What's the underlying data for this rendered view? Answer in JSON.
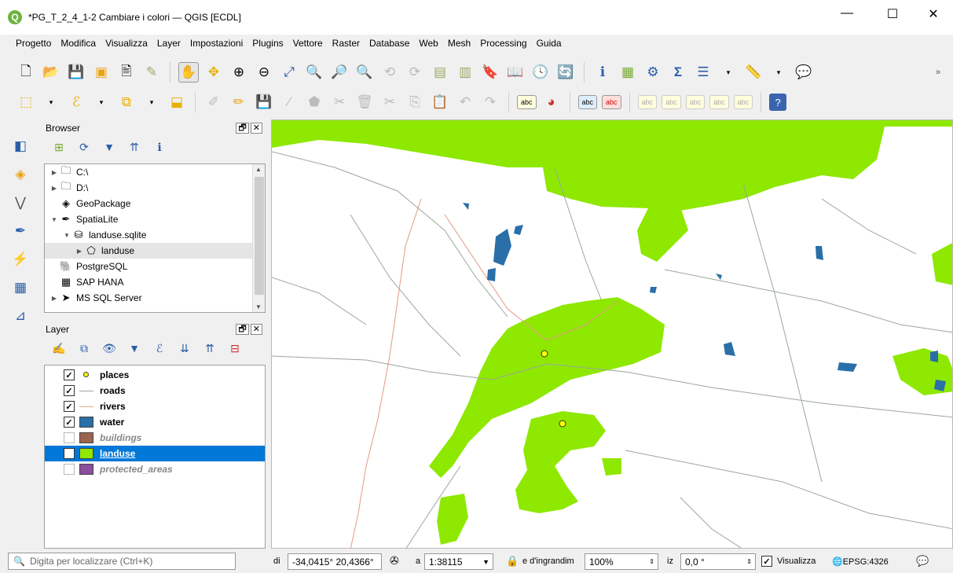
{
  "window": {
    "title": "*PG_T_2_4_1-2 Cambiare i colori — QGIS [ECDL]",
    "logo": "Q",
    "minimize": "—",
    "maximize": "☐",
    "close": "✕"
  },
  "menu": [
    "Progetto",
    "Modifica",
    "Visualizza",
    "Layer",
    "Impostazioni",
    "Plugins",
    "Vettore",
    "Raster",
    "Database",
    "Web",
    "Mesh",
    "Processing",
    "Guida"
  ],
  "toolbar2": {
    "label_abc": "abc"
  },
  "browser": {
    "title": "Browser",
    "float_btn": "🗗",
    "close_btn": "✕",
    "items": [
      {
        "label": "C:\\",
        "icon": "folder-icon",
        "glyph": "🗀",
        "expand": "▶",
        "indent": 0
      },
      {
        "label": "D:\\",
        "icon": "folder-icon",
        "glyph": "🗀",
        "expand": "▶",
        "indent": 0
      },
      {
        "label": "GeoPackage",
        "icon": "geopackage-icon",
        "glyph": "◈",
        "expand": "",
        "indent": 0
      },
      {
        "label": "SpatiaLite",
        "icon": "spatialite-icon",
        "glyph": "✒",
        "expand": "▼",
        "indent": 0
      },
      {
        "label": "landuse.sqlite",
        "icon": "database-icon",
        "glyph": "⛁",
        "expand": "▼",
        "indent": 1
      },
      {
        "label": "landuse",
        "icon": "polygon-layer-icon",
        "glyph": "⬠",
        "expand": "▶",
        "indent": 2
      },
      {
        "label": "PostgreSQL",
        "icon": "postgresql-icon",
        "glyph": "🐘",
        "expand": "",
        "indent": 0
      },
      {
        "label": "SAP HANA",
        "icon": "sap-hana-icon",
        "glyph": "▦",
        "expand": "",
        "indent": 0
      },
      {
        "label": "MS SQL Server",
        "icon": "mssql-icon",
        "glyph": "➤",
        "expand": "▶",
        "indent": 0
      }
    ]
  },
  "layers_panel": {
    "title": "Layer",
    "float_btn": "🗗",
    "close_btn": "✕",
    "layers": [
      {
        "name": "places",
        "checked": true,
        "symbol": "point",
        "color": "#ffff00",
        "active": true,
        "selected": false
      },
      {
        "name": "roads",
        "checked": true,
        "symbol": "line",
        "color": "#a0a0a0",
        "active": true,
        "selected": false
      },
      {
        "name": "rivers",
        "checked": true,
        "symbol": "line",
        "color": "#e8a890",
        "active": true,
        "selected": false
      },
      {
        "name": "water",
        "checked": true,
        "symbol": "fill",
        "color": "#2a6fa8",
        "active": true,
        "selected": false
      },
      {
        "name": "buildings",
        "checked": false,
        "symbol": "fill",
        "color": "#9b6450",
        "active": false,
        "selected": false
      },
      {
        "name": "landuse",
        "checked": true,
        "symbol": "fill",
        "color": "#8ee800",
        "active": true,
        "selected": true
      },
      {
        "name": "protected_areas",
        "checked": false,
        "symbol": "fill",
        "color": "#8a4f9e",
        "active": false,
        "selected": false
      }
    ]
  },
  "statusbar": {
    "locator_placeholder": "Digita per localizzare (Ctrl+K)",
    "coord_label": "di",
    "coordinate": "-34,0415° 20,4366°",
    "scale_label": "a",
    "scale": "1:38115",
    "magnifier_label": "e d'ingrandim",
    "magnifier": "100%",
    "rotation_label": "iz",
    "rotation": "0,0 °",
    "render_label": "Visualizza",
    "render_checked": "✓",
    "crs": "EPSG:4326",
    "messages_icon": "💬"
  },
  "colors": {
    "landuse": "#8ee800",
    "water": "#2a6fa8",
    "roads": "#9aa89a",
    "rivers": "#e39a80",
    "places": "#ffff00",
    "selection": "#0078d7"
  }
}
